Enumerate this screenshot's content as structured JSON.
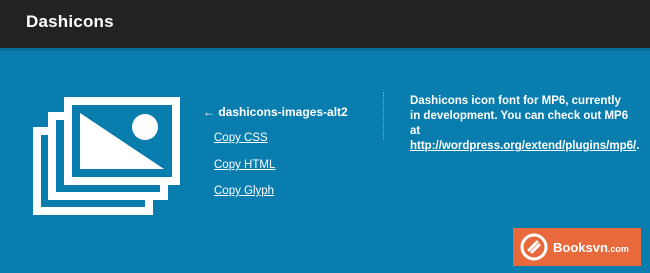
{
  "header": {
    "title": "Dashicons"
  },
  "icon_panel": {
    "icon_name": "images-alt2-icon",
    "caption": "← dashicons-images-alt2",
    "links": {
      "copy_css": "Copy CSS",
      "copy_html": "Copy HTML",
      "copy_glyph": "Copy Glyph"
    }
  },
  "info": {
    "line1": "Dashicons icon font for MP6, currently in development. You can check out MP6 at ",
    "url": "http://wordpress.org/extend/plugins/mp6/",
    "end": "."
  },
  "watermark": {
    "brand": "Booksvn",
    "suffix": ".com"
  },
  "colors": {
    "background": "#0a7daf",
    "topbar": "#222222",
    "watermark": "#e86a3c"
  }
}
